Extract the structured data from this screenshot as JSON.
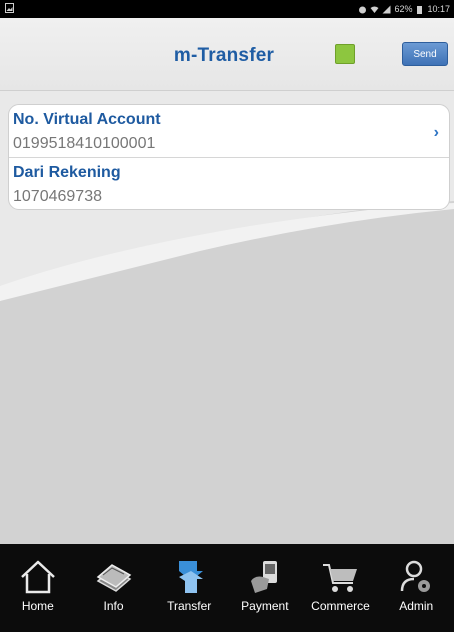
{
  "status_bar": {
    "battery": "62%",
    "time": "10:17"
  },
  "header": {
    "title": "m-Transfer",
    "send_label": "Send",
    "status_color": "#8dc63f"
  },
  "form": {
    "rows": [
      {
        "label": "No. Virtual Account",
        "value": "0199518410100001",
        "chevron": "›"
      },
      {
        "label": "Dari Rekening",
        "value": "1070469738"
      }
    ]
  },
  "nav": {
    "items": [
      {
        "label": "Home",
        "icon": "home-icon"
      },
      {
        "label": "Info",
        "icon": "info-icon"
      },
      {
        "label": "Transfer",
        "icon": "transfer-icon",
        "active": true
      },
      {
        "label": "Payment",
        "icon": "payment-icon"
      },
      {
        "label": "Commerce",
        "icon": "cart-icon"
      },
      {
        "label": "Admin",
        "icon": "admin-icon"
      }
    ]
  },
  "colors": {
    "accent": "#1f5da4",
    "active_nav": "#3a8fd8"
  }
}
